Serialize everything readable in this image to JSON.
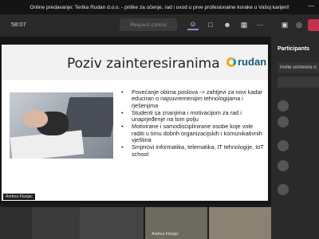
{
  "window": {
    "title": "Online predavanje: Tertka Rudan d.o.o. - prilike za učenje, rad i uvod u prve profesionalne korake u Vašoj karijeri!",
    "minimize_glyph": "—"
  },
  "toolbar": {
    "timer": "58:07",
    "request_control": "Request control",
    "icons": [
      "people-icon",
      "chat-icon",
      "reactions-icon",
      "rooms-icon",
      "more-icon",
      "camera-icon",
      "mic-icon",
      "share-icon"
    ]
  },
  "slide": {
    "title": "Poziv zainteresiranima",
    "logo_text": "rudan",
    "bullets": [
      "Povećanje obima poslova -> zahtjevi za novi kadar educiran o najsuvremenijim tehnologijama i rješenjima",
      "Studenti sa znanjima i motivacijom za rad i unaprjeđenje na tom polju",
      "Motivirane i samodisciplinirane osobe koje vole raditi u timu dobrih organizacijskih i komunikativnih vještina",
      "Smjerovi informatika, telematika, IT tehnologije, IoT school"
    ]
  },
  "presenter": {
    "name": "Andrea Klanjac"
  },
  "participants_panel": {
    "title": "Participants",
    "invite_placeholder": "Invite someone o"
  },
  "bottom_tile": {
    "label": "Andrea Klanjac"
  },
  "colors": {
    "hangup": "#c4314b",
    "active_tab": "#8b8cc7",
    "logo_blue": "#1a5a73",
    "logo_orange": "#f5a623"
  }
}
